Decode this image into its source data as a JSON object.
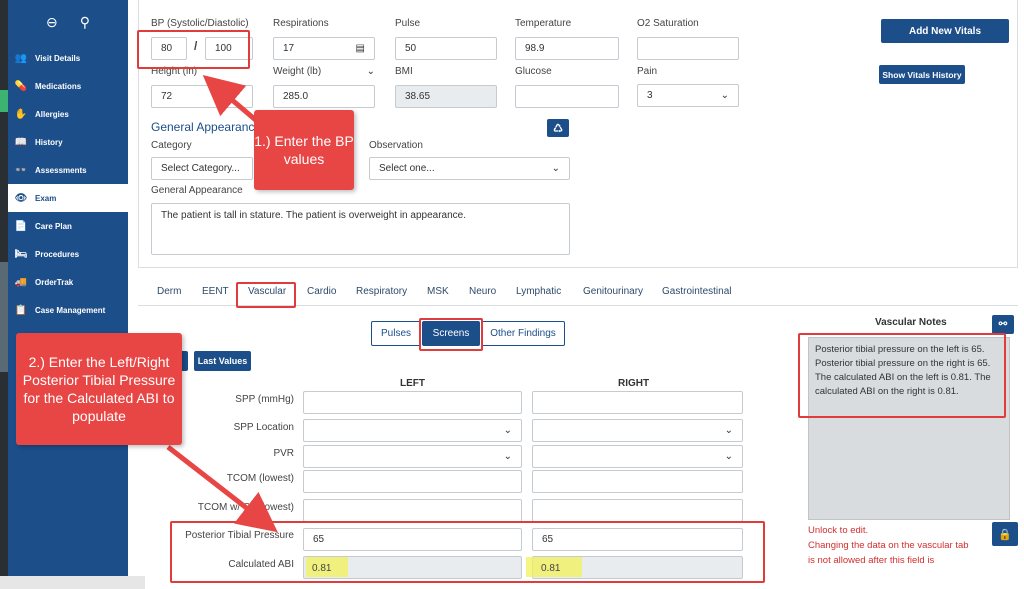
{
  "sidebar": {
    "top_icons": [
      "back-circle-icon",
      "search-icon"
    ],
    "items": [
      {
        "label": "Visit Details",
        "icon": "users-icon",
        "glyph": "👥"
      },
      {
        "label": "Medications",
        "icon": "medications-icon",
        "glyph": "💊"
      },
      {
        "label": "Allergies",
        "icon": "hand-icon",
        "glyph": "✋"
      },
      {
        "label": "History",
        "icon": "book-icon",
        "glyph": "📖"
      },
      {
        "label": "Assessments",
        "icon": "glasses-icon",
        "glyph": "👓"
      },
      {
        "label": "Exam",
        "icon": "eye-icon",
        "glyph": "👁"
      },
      {
        "label": "Care Plan",
        "icon": "document-icon",
        "glyph": "📄"
      },
      {
        "label": "Procedures",
        "icon": "bed-icon",
        "glyph": "🛏"
      },
      {
        "label": "OrderTrak",
        "icon": "truck-icon",
        "glyph": "🚚"
      },
      {
        "label": "Case Management",
        "icon": "clipboard-icon",
        "glyph": "📋"
      }
    ],
    "active": "Exam"
  },
  "vitals": {
    "bp_label": "BP (Systolic/Diastolic)",
    "bp_systolic": "80",
    "bp_separator": "/",
    "bp_diastolic": "100",
    "respirations_label": "Respirations",
    "respirations": "17",
    "pulse_label": "Pulse",
    "pulse": "50",
    "temperature_label": "Temperature",
    "temperature": "98.9",
    "o2_label": "O2 Saturation",
    "o2": "",
    "height_label": "Height (in)",
    "height": "72",
    "weight_label": "Weight (lb)",
    "weight": "285.0",
    "bmi_label": "BMI",
    "bmi": "38.65",
    "glucose_label": "Glucose",
    "glucose": "",
    "pain_label": "Pain",
    "pain": "3",
    "add_button": "Add New Vitals",
    "history_button": "Show Vitals History"
  },
  "general_appearance": {
    "title": "General Appearance",
    "category_label": "Category",
    "category_placeholder": "Select Category...",
    "observation_label": "Observation",
    "observation_placeholder": "Select one...",
    "text_label": "General Appearance",
    "text": "The patient is tall in stature. The patient is overweight in appearance."
  },
  "tabs": [
    "Derm",
    "EENT",
    "Vascular",
    "Cardio",
    "Respiratory",
    "MSK",
    "Neuro",
    "Lymphatic",
    "Genitourinary",
    "Gastrointestinal"
  ],
  "active_tab": "Vascular",
  "subtabs": [
    "Pulses",
    "Screens",
    "Other Findings"
  ],
  "active_subtab": "Screens",
  "last_values_button": "Last Values",
  "screens": {
    "left_header": "LEFT",
    "right_header": "RIGHT",
    "rows": {
      "spp": "SPP (mmHg)",
      "spp_location": "SPP Location",
      "pvr": "PVR",
      "tcom": "TCOM (lowest)",
      "tcom_o2": "TCOM w/ O2 (lowest)",
      "ptp": "Posterior Tibial Pressure",
      "abi": "Calculated ABI"
    },
    "ptp_left": "65",
    "ptp_right": "65",
    "abi_left": "0.81",
    "abi_right": "0.81"
  },
  "vascular_notes": {
    "title": "Vascular Notes",
    "text": "Posterior tibial pressure on the left is 65. Posterior tibial pressure on the right is 65. The calculated ABI on the left is 0.81. The calculated ABI on the right is 0.81.",
    "unlock": "Unlock to edit.",
    "warning_1": "Changing the data on the vascular tab",
    "warning_2": "is not allowed after this field is"
  },
  "annotations": {
    "callout_1": "1.) Enter the BP values",
    "callout_2": "2.) Enter the Left/Right Posterior Tibial Pressure for the Calculated ABI to populate",
    "color": "#e84545"
  },
  "colors": {
    "brand": "#1c4e8a",
    "annotation": "#e03c3c",
    "highlight": "#f2f25a"
  }
}
